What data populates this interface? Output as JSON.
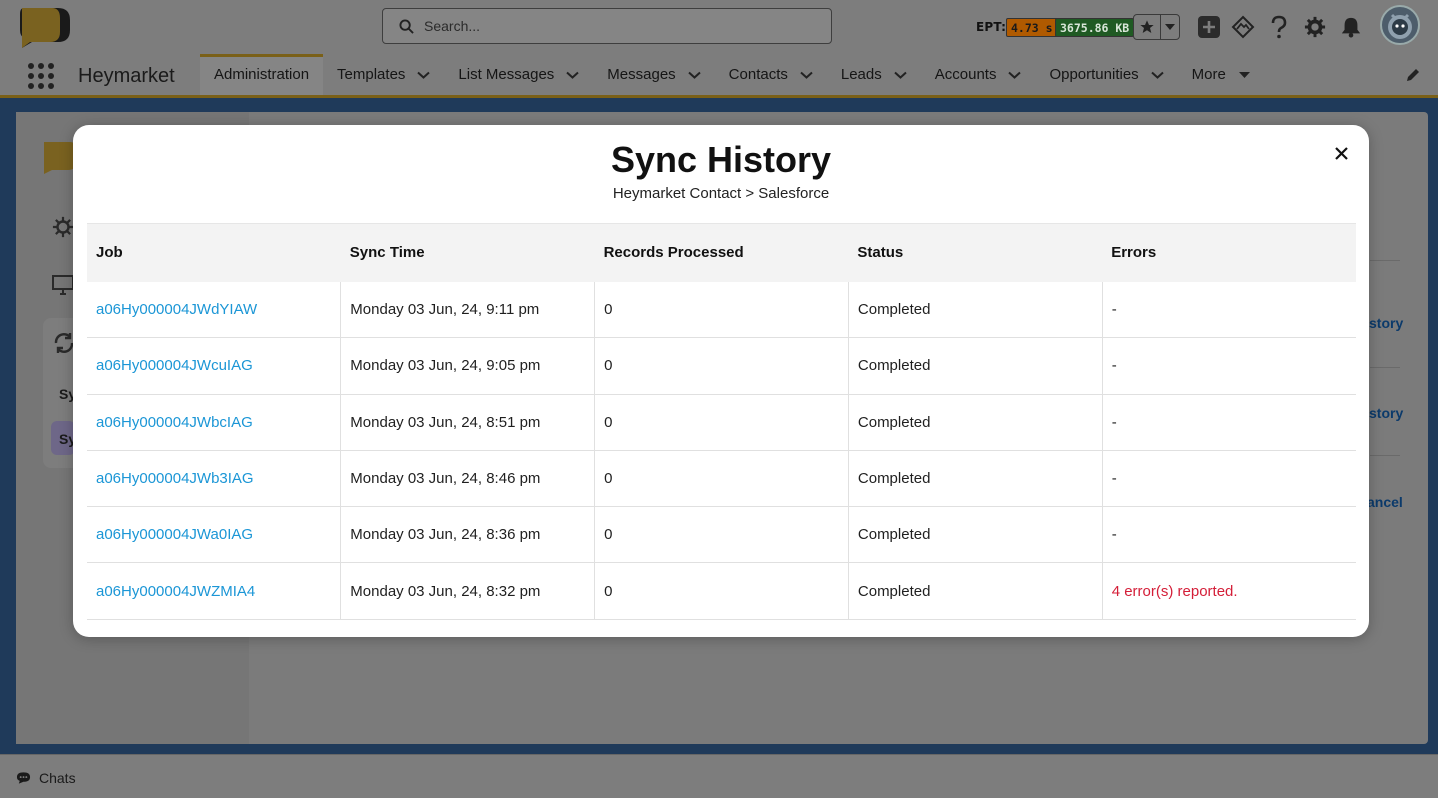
{
  "header": {
    "search_placeholder": "Search...",
    "ept_label": "EPT:",
    "ept_time": "4.73 s",
    "ept_memory": "3675.86 KB"
  },
  "nav": {
    "app_name": "Heymarket",
    "tabs": [
      {
        "label": "Administration",
        "has_menu": false,
        "active": true
      },
      {
        "label": "Templates",
        "has_menu": true
      },
      {
        "label": "List Messages",
        "has_menu": true
      },
      {
        "label": "Messages",
        "has_menu": true
      },
      {
        "label": "Contacts",
        "has_menu": true
      },
      {
        "label": "Leads",
        "has_menu": true
      },
      {
        "label": "Accounts",
        "has_menu": true
      },
      {
        "label": "Opportunities",
        "has_menu": true
      },
      {
        "label": "More",
        "has_menu": true
      }
    ]
  },
  "background": {
    "sidebar_item_1": "Sy",
    "sidebar_item_2": "Sy",
    "link_1": "story",
    "link_2": "story",
    "link_3": "ancel"
  },
  "modal": {
    "title": "Sync History",
    "subtitle": "Heymarket Contact > Salesforce",
    "columns": [
      "Job",
      "Sync Time",
      "Records Processed",
      "Status",
      "Errors"
    ],
    "rows": [
      {
        "job": "a06Hy000004JWdYIAW",
        "sync_time": "Monday 03 Jun, 24, 9:11 pm",
        "records": "0",
        "status": "Completed",
        "errors": "-"
      },
      {
        "job": "a06Hy000004JWcuIAG",
        "sync_time": "Monday 03 Jun, 24, 9:05 pm",
        "records": "0",
        "status": "Completed",
        "errors": "-"
      },
      {
        "job": "a06Hy000004JWbcIAG",
        "sync_time": "Monday 03 Jun, 24, 8:51 pm",
        "records": "0",
        "status": "Completed",
        "errors": "-"
      },
      {
        "job": "a06Hy000004JWb3IAG",
        "sync_time": "Monday 03 Jun, 24, 8:46 pm",
        "records": "0",
        "status": "Completed",
        "errors": "-"
      },
      {
        "job": "a06Hy000004JWa0IAG",
        "sync_time": "Monday 03 Jun, 24, 8:36 pm",
        "records": "0",
        "status": "Completed",
        "errors": "-"
      },
      {
        "job": "a06Hy000004JWZMIA4",
        "sync_time": "Monday 03 Jun, 24, 8:32 pm",
        "records": "0",
        "status": "Completed",
        "errors": "4 error(s) reported."
      }
    ]
  },
  "footer": {
    "chats_label": "Chats"
  },
  "colors": {
    "link": "#1b96d6",
    "error": "#d41e38",
    "brand_accent": "#7a6018"
  }
}
